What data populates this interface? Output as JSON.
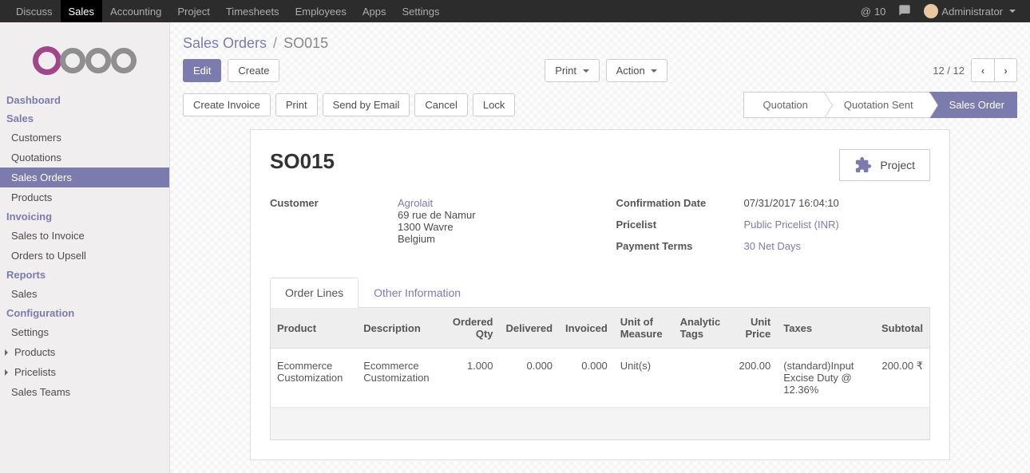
{
  "topnav": {
    "items": [
      "Discuss",
      "Sales",
      "Accounting",
      "Project",
      "Timesheets",
      "Employees",
      "Apps",
      "Settings"
    ],
    "active_index": 1,
    "msg_count": "10",
    "user": "Administrator"
  },
  "sidebar": {
    "section1": {
      "header": "Dashboard"
    },
    "section2": {
      "header": "Sales",
      "items": [
        "Customers",
        "Quotations",
        "Sales Orders",
        "Products"
      ],
      "active_index": 2
    },
    "section3": {
      "header": "Invoicing",
      "items": [
        "Sales to Invoice",
        "Orders to Upsell"
      ]
    },
    "section4": {
      "header": "Reports",
      "items": [
        "Sales"
      ]
    },
    "section5": {
      "header": "Configuration",
      "items": [
        "Settings",
        "Products",
        "Pricelists",
        "Sales Teams"
      ]
    }
  },
  "breadcrumb": {
    "parent": "Sales Orders",
    "sep": "/",
    "current": "SO015"
  },
  "buttons": {
    "edit": "Edit",
    "create": "Create",
    "print": "Print",
    "action": "Action",
    "create_invoice": "Create Invoice",
    "print2": "Print",
    "send_email": "Send by Email",
    "cancel": "Cancel",
    "lock": "Lock"
  },
  "pager": {
    "text": "12 / 12"
  },
  "status": {
    "s1": "Quotation",
    "s2": "Quotation Sent",
    "s3": "Sales Order"
  },
  "order": {
    "name": "SO015",
    "project_btn": "Project",
    "labels": {
      "customer": "Customer",
      "conf_date": "Confirmation Date",
      "pricelist": "Pricelist",
      "terms": "Payment Terms"
    },
    "customer_name": "Agrolait",
    "addr1": "69 rue de Namur",
    "addr2": "1300 Wavre",
    "addr3": "Belgium",
    "conf_date": "07/31/2017 16:04:10",
    "pricelist": "Public Pricelist (INR)",
    "terms": "30 Net Days"
  },
  "tabs": {
    "t1": "Order Lines",
    "t2": "Other Information"
  },
  "table": {
    "headers": {
      "product": "Product",
      "desc": "Description",
      "qty": "Ordered Qty",
      "delivered": "Delivered",
      "invoiced": "Invoiced",
      "uom": "Unit of Measure",
      "tags": "Analytic Tags",
      "price": "Unit Price",
      "taxes": "Taxes",
      "subtotal": "Subtotal"
    },
    "row": {
      "product": "Ecommerce Customization",
      "desc": "Ecommerce Customization",
      "qty": "1.000",
      "delivered": "0.000",
      "invoiced": "0.000",
      "uom": "Unit(s)",
      "tags": "",
      "price": "200.00",
      "taxes": "(standard)Input Excise Duty @ 12.36%",
      "subtotal": "200.00 ₹"
    }
  }
}
